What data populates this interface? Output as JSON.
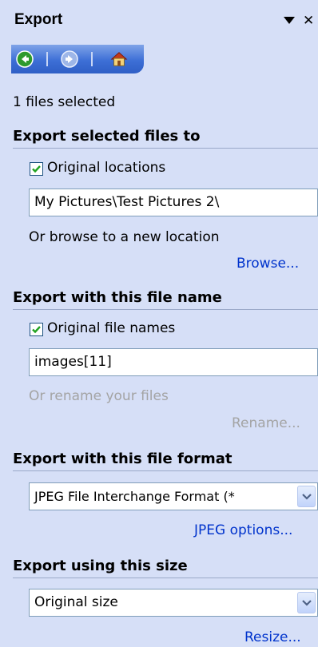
{
  "panel": {
    "title": "Export"
  },
  "nav": {
    "back_icon": "back-arrow-icon",
    "forward_icon": "forward-arrow-icon",
    "home_icon": "home-icon"
  },
  "selection_status": "1 files selected",
  "location_section": {
    "heading": "Export selected files to",
    "checkbox_label": "Original locations",
    "checkbox_checked": true,
    "path_value": "My Pictures\\Test Pictures 2\\",
    "browse_hint": "Or browse to a new location",
    "browse_link": "Browse..."
  },
  "filename_section": {
    "heading": "Export with this file name",
    "checkbox_label": "Original file names",
    "checkbox_checked": true,
    "name_value": "images[11]",
    "rename_hint": "Or rename your files",
    "rename_link": "Rename..."
  },
  "format_section": {
    "heading": "Export with this file format",
    "selected_format": "JPEG File Interchange Format (*",
    "options_link": "JPEG options..."
  },
  "size_section": {
    "heading": "Export using this size",
    "selected_size": "Original size",
    "resize_link": "Resize..."
  },
  "colors": {
    "pane_background": "#d6dff7",
    "nav_bar": "#3d6fd6",
    "link": "#0033cc",
    "disabled_text": "#a4a4a4",
    "checkbox_check": "#22a322"
  }
}
